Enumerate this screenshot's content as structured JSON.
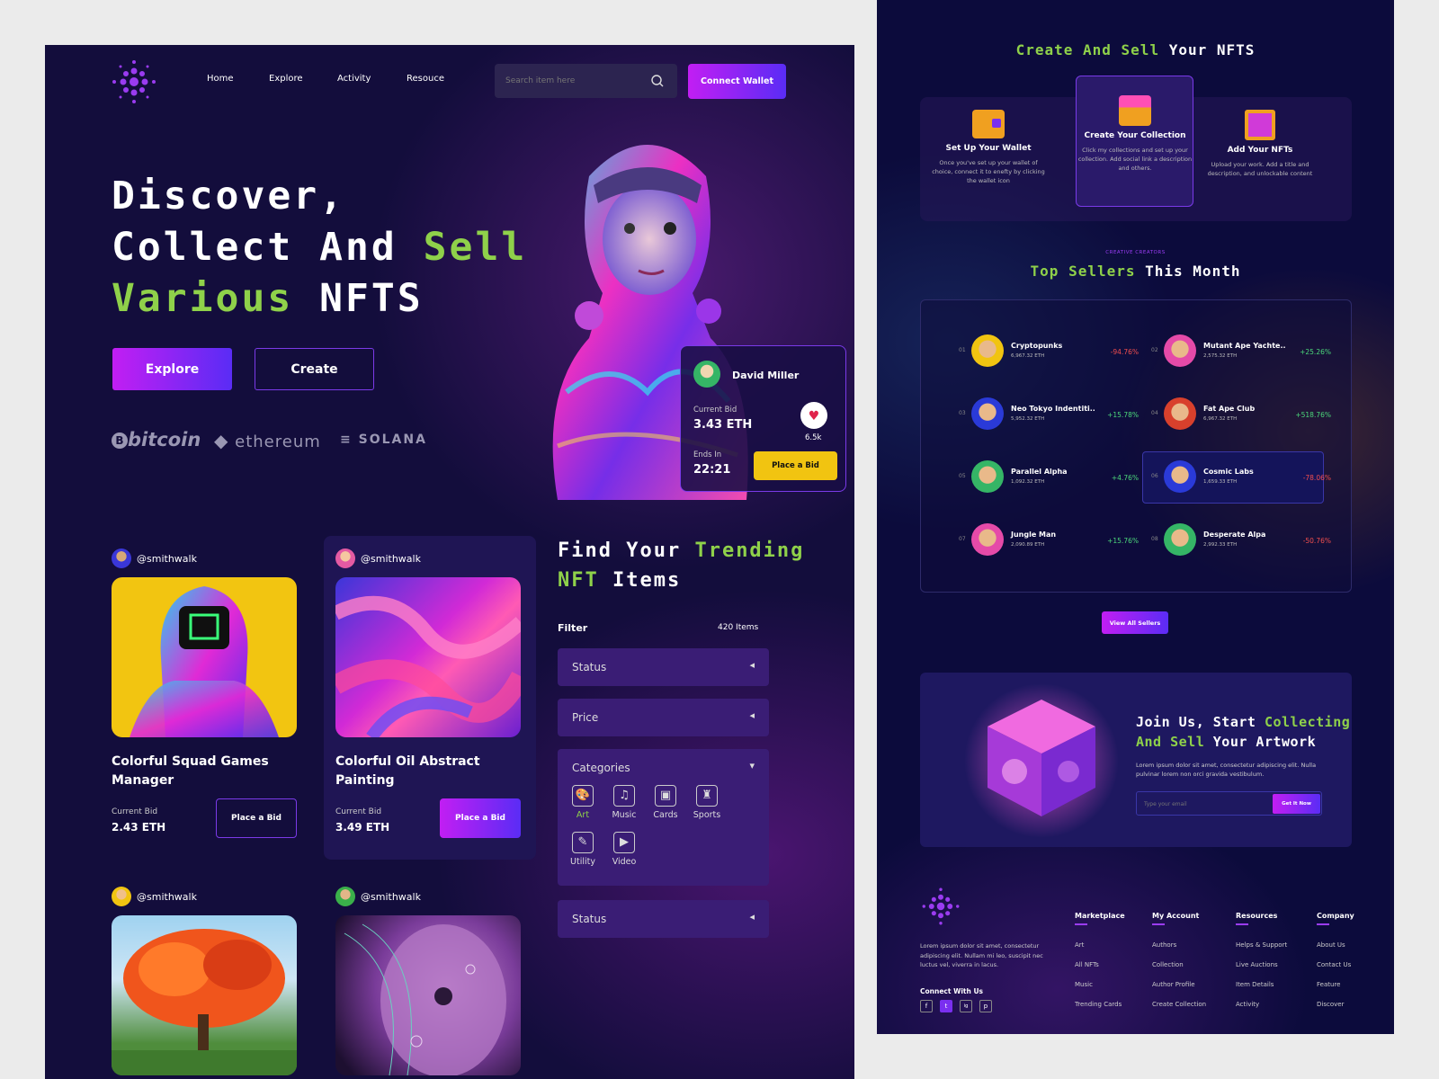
{
  "nav": {
    "items": [
      "Home",
      "Explore",
      "Activity",
      "Resouce"
    ],
    "search_placeholder": "Search item here",
    "connect_label": "Connect Wallet"
  },
  "hero": {
    "line1": "Discover,",
    "line2_a": "Collect And ",
    "line2_b": "Sell",
    "line3_a": "Various",
    "line3_b": " NFTS",
    "explore_label": "Explore",
    "create_label": "Create",
    "partners": [
      "bitcoin",
      "ethereum",
      "SOLANA"
    ]
  },
  "bid_card": {
    "name": "David Miller",
    "current_bid_label": "Current Bid",
    "current_bid": "3.43 ETH",
    "likes": "6.5k",
    "ends_label": "Ends In",
    "ends": "22:21",
    "button": "Place a Bid"
  },
  "cards": [
    {
      "user": "@smithwalk",
      "title": "Colorful Squad Games Manager",
      "bid_label": "Current Bid",
      "bid": "2.43 ETH",
      "button": "Place a Bid"
    },
    {
      "user": "@smithwalk",
      "title": "Colorful Oil Abstract Painting",
      "bid_label": "Current Bid",
      "bid": "3.49 ETH",
      "button": "Place a Bid"
    },
    {
      "user": "@smithwalk"
    },
    {
      "user": "@smithwalk"
    }
  ],
  "trending": {
    "title_a": "Find Your ",
    "title_b": "Trending",
    "title_c": "NFT",
    "title_d": " Items",
    "filter_label": "Filter",
    "count": "420 Items",
    "status_label": "Status",
    "price_label": "Price",
    "categories_label": "Categories",
    "categories": [
      "Art",
      "Music",
      "Cards",
      "Sports",
      "Utility",
      "Video"
    ],
    "status2_label": "Status"
  },
  "create_sell": {
    "title_a": "Create And Sell",
    "title_b": " Your NFTS",
    "steps": [
      {
        "title": "Set Up Your Wallet",
        "desc": "Once you've set up your wallet of choice, connect it to enefty by clicking the wallet icon"
      },
      {
        "title": "Create Your Collection",
        "desc": "Click my collections and set up your collection. Add social link a description and others."
      },
      {
        "title": "Add Your NFTs",
        "desc": "Upload your work. Add a title and description, and unlockable content"
      }
    ]
  },
  "sellers": {
    "kicker": "CREATIVE CREATORS",
    "title_a": "Top Sellers",
    "title_b": " This Month",
    "list": [
      {
        "rank": "01",
        "name": "Cryptopunks",
        "eth": "6,967.32 ETH",
        "change": "-94.76%",
        "dir": "down"
      },
      {
        "rank": "02",
        "name": "Mutant Ape Yachte..",
        "eth": "2,575.32 ETH",
        "change": "+25.26%",
        "dir": "up"
      },
      {
        "rank": "03",
        "name": "Neo Tokyo Indentiti..",
        "eth": "5,952.32 ETH",
        "change": "+15.78%",
        "dir": "up"
      },
      {
        "rank": "04",
        "name": "Fat Ape Club",
        "eth": "6,967.32 ETH",
        "change": "+518.76%",
        "dir": "up"
      },
      {
        "rank": "05",
        "name": "Parallel Alpha",
        "eth": "1,092.32 ETH",
        "change": "+4.76%",
        "dir": "up"
      },
      {
        "rank": "06",
        "name": "Cosmic Labs",
        "eth": "1,659.33 ETH",
        "change": "-78.06%",
        "dir": "down"
      },
      {
        "rank": "07",
        "name": "Jungle Man",
        "eth": "2,090.89 ETH",
        "change": "+15.76%",
        "dir": "up"
      },
      {
        "rank": "08",
        "name": "Desperate Alpa",
        "eth": "2,992.33 ETH",
        "change": "-50.76%",
        "dir": "down"
      }
    ],
    "view_all": "View All Sellers"
  },
  "join": {
    "title_a": "Join Us, Start ",
    "title_b": "Collecting",
    "title_c": "And Sell",
    "title_d": " Your Artwork",
    "desc": "Lorem ipsum dolor sit amet, consectetur adipiscing elit. Nulla pulvinar lorem non orci gravida vestibulum.",
    "email_placeholder": "Type your email",
    "button": "Get It Now"
  },
  "footer": {
    "about": "Lorem ipsum dolor sit amet, consectetur adipiscing elit. Nullam mi leo, suscipit nec luctus vel, viverra in lacus.",
    "connect": "Connect With Us",
    "social": [
      "f",
      "t",
      "ig",
      "p"
    ],
    "cols": [
      {
        "title": "Marketplace",
        "items": [
          "Art",
          "All NFTs",
          "Music",
          "Trending Cards"
        ]
      },
      {
        "title": "My Account",
        "items": [
          "Authors",
          "Collection",
          "Author Profile",
          "Create Collection"
        ]
      },
      {
        "title": "Resources",
        "items": [
          "Helps & Support",
          "Live Auctions",
          "Item Details",
          "Activity"
        ]
      },
      {
        "title": "Company",
        "items": [
          "About Us",
          "Contact Us",
          "Feature",
          "Discover"
        ]
      }
    ]
  },
  "colors": {
    "accent": "#b61ff2",
    "green": "#8fd14a",
    "yellow": "#f1c411",
    "bg": "#130d3c"
  }
}
